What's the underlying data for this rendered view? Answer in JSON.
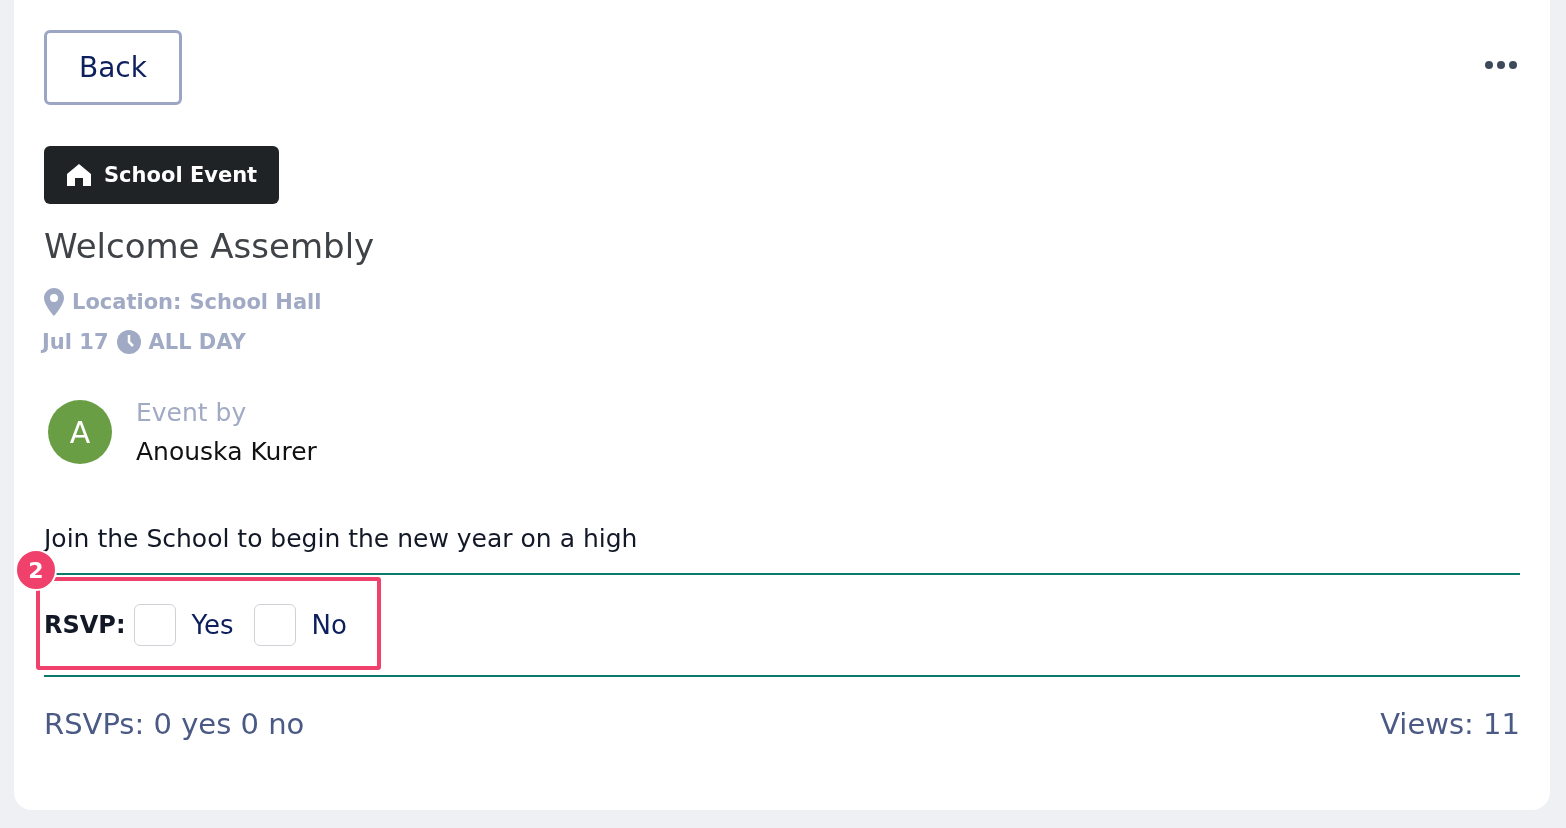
{
  "back_button": {
    "label": "Back"
  },
  "category": {
    "label": "School Event"
  },
  "title": "Welcome Assembly",
  "location": {
    "label": "Location:",
    "value": "School Hall"
  },
  "when": {
    "date": "Jul 17",
    "time": "ALL DAY"
  },
  "author": {
    "initial": "A",
    "caption": "Event by",
    "name": "Anouska Kurer"
  },
  "description": "Join the School to begin the new year on a high",
  "rsvp": {
    "label": "RSVP:",
    "options": [
      {
        "label": "Yes",
        "checked": false
      },
      {
        "label": "No",
        "checked": false
      }
    ]
  },
  "annotation": {
    "number": "2"
  },
  "footer": {
    "rsvps": "RSVPs: 0 yes 0 no",
    "views": "Views: 11"
  }
}
